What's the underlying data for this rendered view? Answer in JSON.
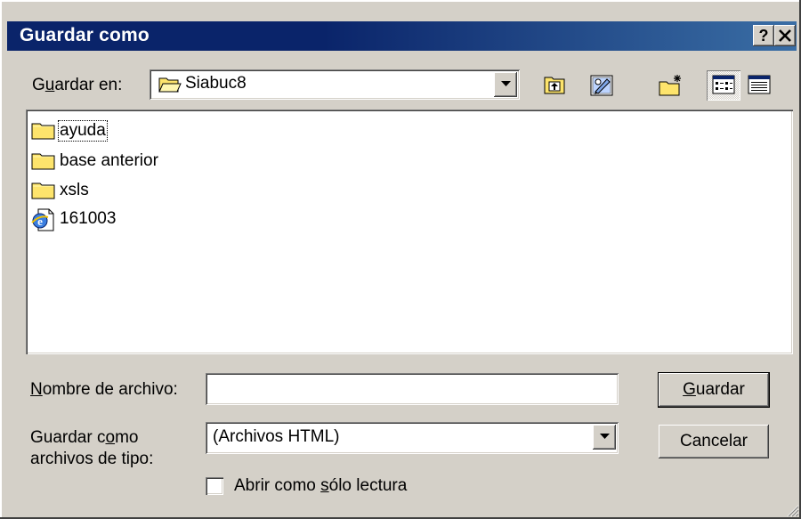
{
  "window": {
    "title": "Guardar como",
    "help_glyph": "?",
    "close_icon": "close-icon"
  },
  "lookin": {
    "label_pre": "G",
    "label_key": "u",
    "label_post": "ardar en:",
    "value": "Siabuc8",
    "icon": "folder-open-icon"
  },
  "toolbar": {
    "buttons": [
      {
        "name": "up-one-level-button",
        "icon": "folder-up-icon"
      },
      {
        "name": "desktop-button",
        "icon": "desktop-icon"
      },
      {
        "name": "new-folder-button",
        "icon": "new-folder-icon"
      },
      {
        "name": "list-view-button",
        "icon": "list-view-icon",
        "pressed": true
      },
      {
        "name": "details-view-button",
        "icon": "details-view-icon"
      }
    ]
  },
  "files": [
    {
      "name": "ayuda",
      "icon": "folder-icon",
      "focused": true
    },
    {
      "name": "base anterior",
      "icon": "folder-icon"
    },
    {
      "name": "xsls",
      "icon": "folder-icon"
    },
    {
      "name": "161003",
      "icon": "ie-document-icon"
    }
  ],
  "filename": {
    "label_key": "N",
    "label_post": "ombre de archivo:",
    "value": ""
  },
  "filetype": {
    "line1_pre": "Guardar c",
    "line1_key": "o",
    "line1_post": "mo",
    "line2": "archivos de tipo:",
    "value": "(Archivos HTML)"
  },
  "buttons": {
    "save_key": "G",
    "save_post": "uardar",
    "cancel": "Cancelar"
  },
  "readonly": {
    "label_pre": "Abrir como ",
    "label_key": "s",
    "label_post": "ólo lectura",
    "checked": false
  },
  "colors": {
    "titlebar_start": "#0a246a",
    "titlebar_end": "#3a6ea5",
    "face": "#d4d0c8",
    "folder": "#fde46c"
  }
}
